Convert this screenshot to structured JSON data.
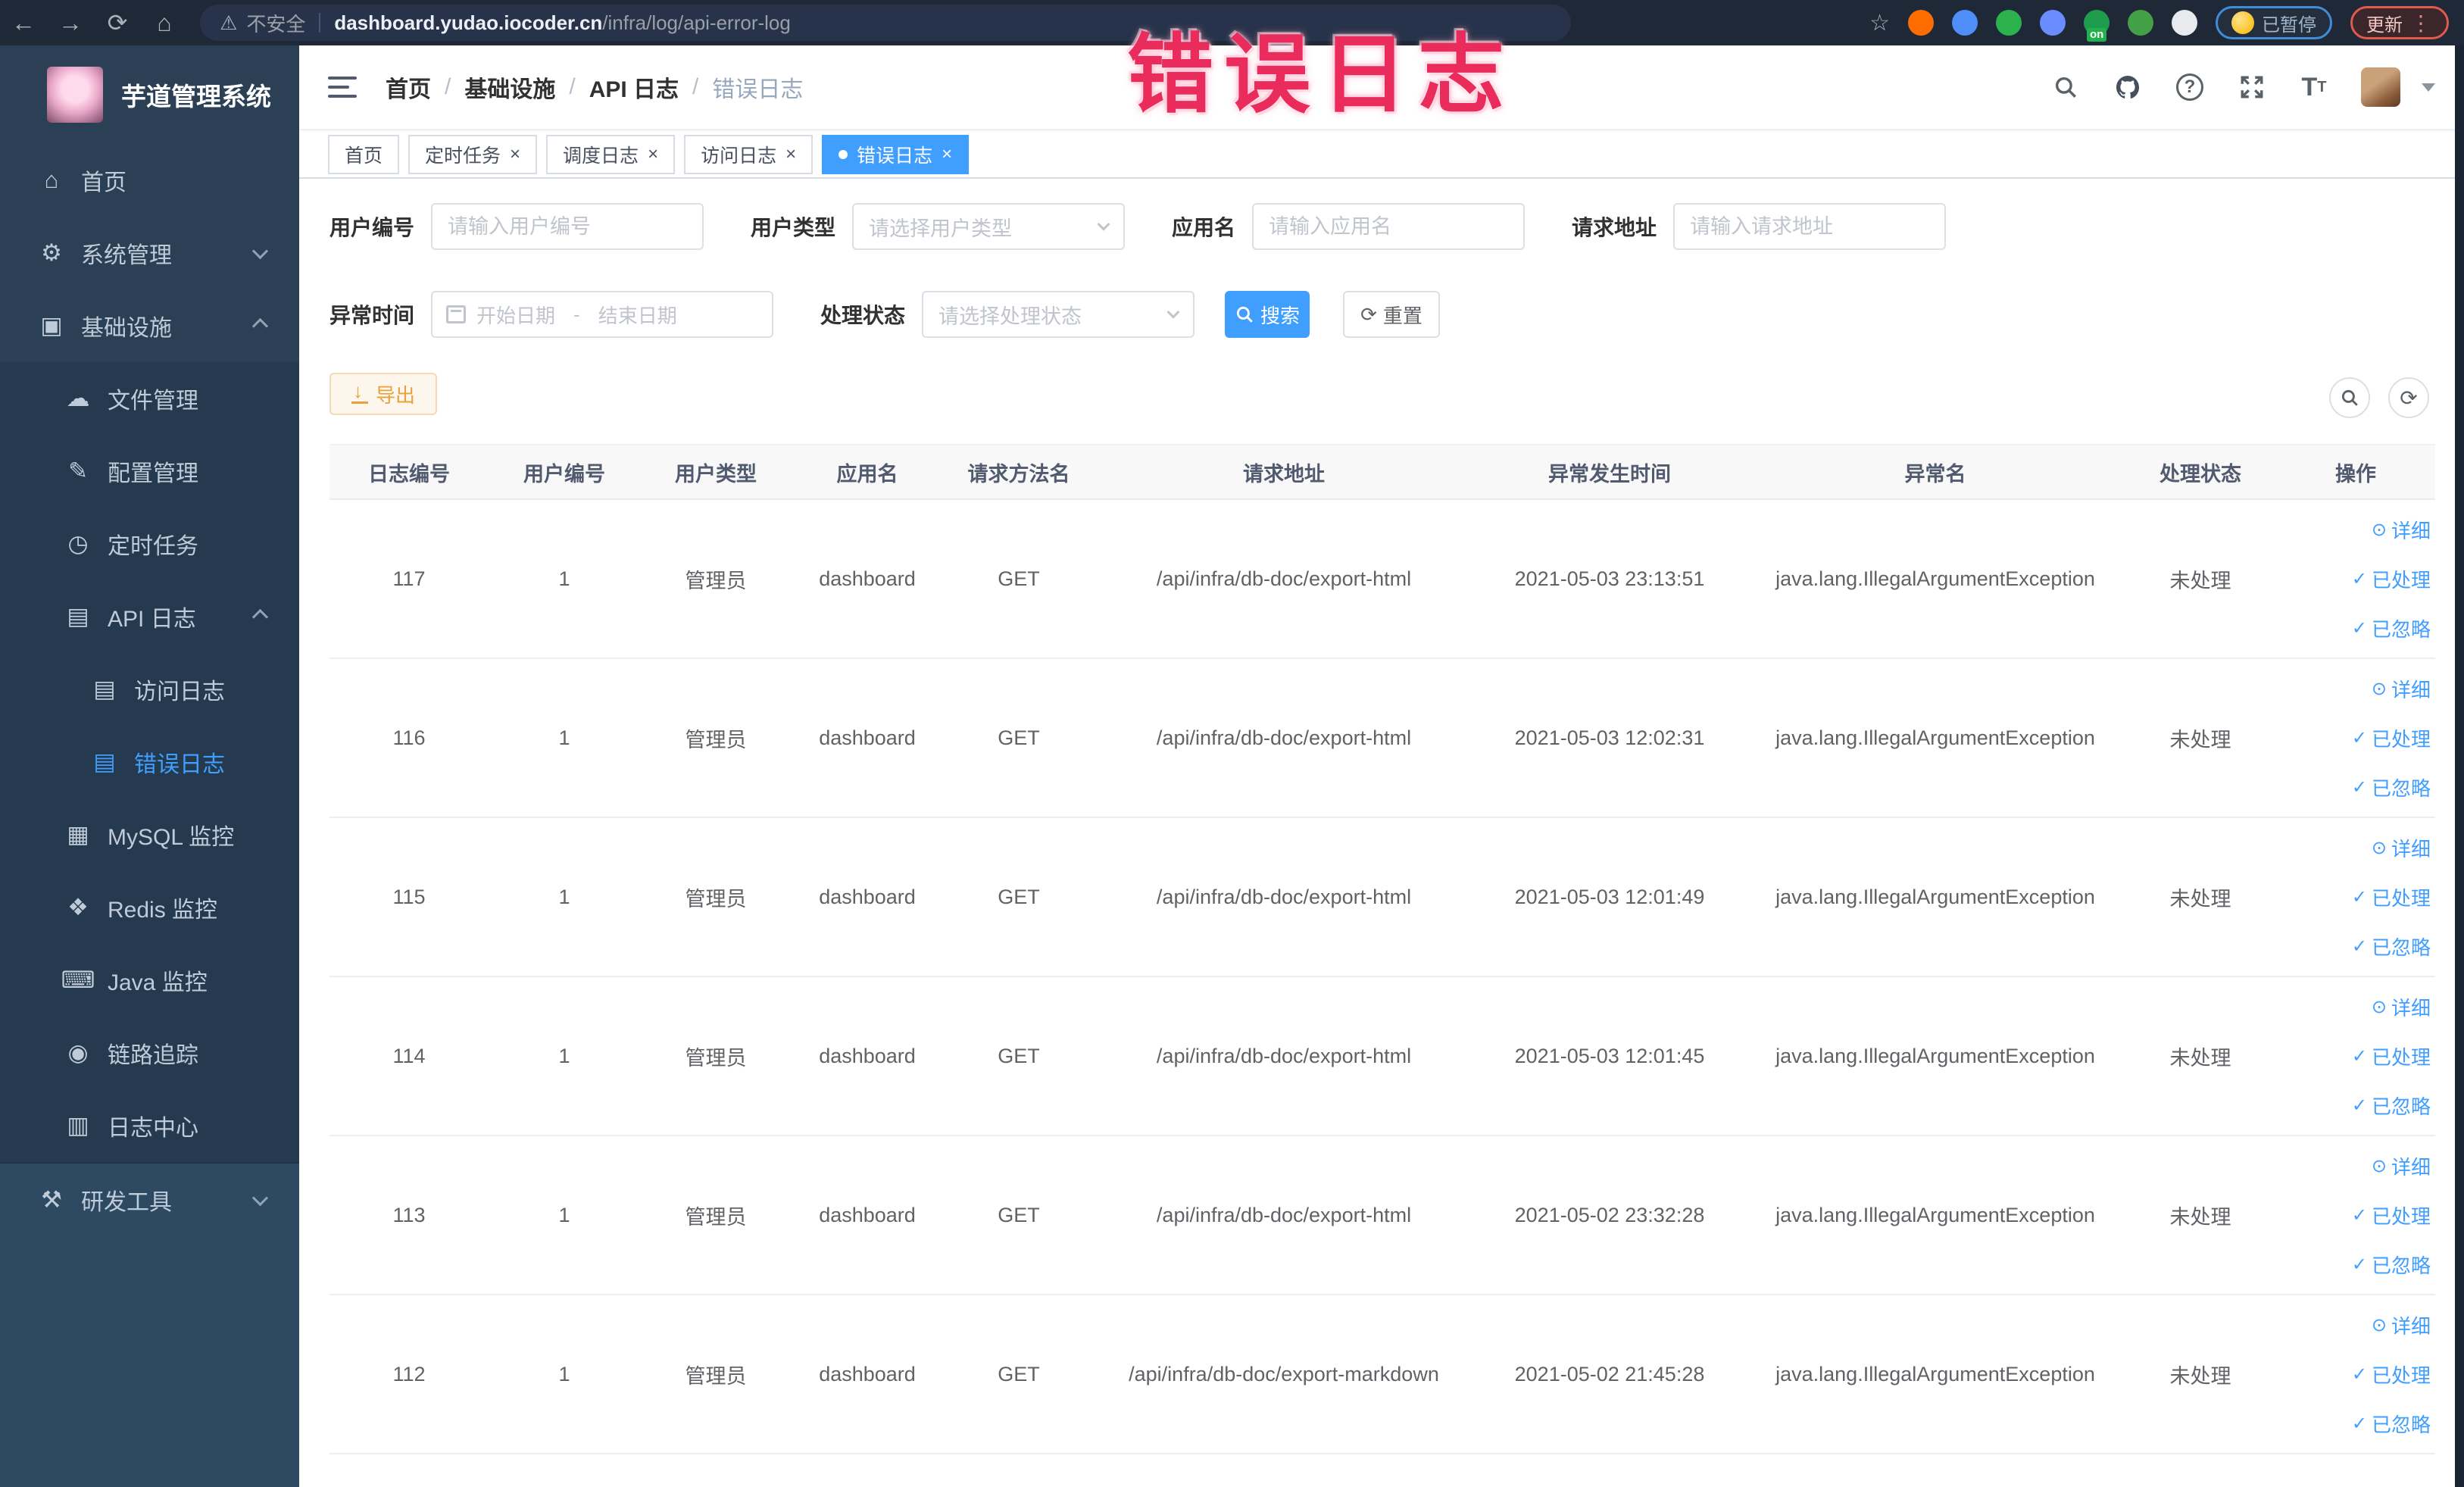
{
  "browser": {
    "security": "不安全",
    "url_domain": "dashboard.yudao.iocoder.cn",
    "url_path": "/infra/log/api-error-log",
    "paused_label": "已暂停",
    "update_label": "更新",
    "extensions": [
      {
        "name": "extension-orange-icon",
        "color": "#ff6d00"
      },
      {
        "name": "extension-blue-drop-icon",
        "color": "#4f8ef7"
      },
      {
        "name": "extension-green-v-icon",
        "color": "#2bb24c"
      },
      {
        "name": "extension-grid-icon",
        "color": "#6a8cff"
      },
      {
        "name": "extension-switch-icon",
        "color": "#1f9d4e",
        "badge": "on"
      },
      {
        "name": "extension-leaf-icon",
        "color": "#43a047"
      },
      {
        "name": "extension-paw-icon",
        "color": "#e8eaed"
      }
    ]
  },
  "overlay": {
    "title": "错误日志",
    "color": "#ea2c5c"
  },
  "sidebar": {
    "app_title": "芋道管理系统",
    "top_items": [
      {
        "label": "首页",
        "icon": "home",
        "level": "l1"
      },
      {
        "label": "系统管理",
        "icon": "gear",
        "level": "l1",
        "chevron": "down"
      },
      {
        "label": "基础设施",
        "icon": "infra",
        "level": "l1",
        "chevron": "up"
      }
    ],
    "sub_items": [
      {
        "label": "文件管理",
        "icon": "cloud",
        "level": "l2"
      },
      {
        "label": "配置管理",
        "icon": "edit",
        "level": "l2"
      },
      {
        "label": "定时任务",
        "icon": "timer",
        "level": "l2"
      },
      {
        "label": "API 日志",
        "icon": "apilog",
        "level": "l2",
        "chevron": "up"
      },
      {
        "label": "访问日志",
        "icon": "doclog",
        "level": "l3"
      },
      {
        "label": "错误日志",
        "icon": "doclog",
        "level": "l3",
        "active": true
      },
      {
        "label": "MySQL 监控",
        "icon": "mysql",
        "level": "l2"
      },
      {
        "label": "Redis 监控",
        "icon": "redis",
        "level": "l2"
      },
      {
        "label": "Java 监控",
        "icon": "java",
        "level": "l2"
      },
      {
        "label": "链路追踪",
        "icon": "trace",
        "level": "l2"
      },
      {
        "label": "日志中心",
        "icon": "logcenter",
        "level": "l2"
      }
    ],
    "bottom_items": [
      {
        "label": "研发工具",
        "icon": "tools",
        "level": "l1",
        "chevron": "down"
      }
    ]
  },
  "breadcrumb": [
    {
      "label": "首页",
      "sep": "/"
    },
    {
      "label": "基础设施",
      "sep": "/"
    },
    {
      "label": "API 日志",
      "sep": "/"
    },
    {
      "label": "错误日志",
      "current": true
    }
  ],
  "tabs": [
    {
      "label": "首页"
    },
    {
      "label": "定时任务",
      "closable": true
    },
    {
      "label": "调度日志",
      "closable": true
    },
    {
      "label": "访问日志",
      "closable": true
    },
    {
      "label": "错误日志",
      "closable": true,
      "active": true
    }
  ],
  "filters": {
    "user_id_label": "用户编号",
    "user_id_placeholder": "请输入用户编号",
    "user_type_label": "用户类型",
    "user_type_placeholder": "请选择用户类型",
    "app_name_label": "应用名",
    "app_name_placeholder": "请输入应用名",
    "request_url_label": "请求地址",
    "request_url_placeholder": "请输入请求地址",
    "time_label": "异常时间",
    "time_start_placeholder": "开始日期",
    "time_separator": "-",
    "time_end_placeholder": "结束日期",
    "status_label": "处理状态",
    "status_placeholder": "请选择处理状态",
    "search_label": "搜索",
    "reset_label": "重置"
  },
  "toolbar": {
    "export_label": "导出"
  },
  "table": {
    "columns": [
      {
        "label": "日志编号",
        "cls": "c1"
      },
      {
        "label": "用户编号",
        "cls": "c2"
      },
      {
        "label": "用户类型",
        "cls": "c3"
      },
      {
        "label": "应用名",
        "cls": "c4"
      },
      {
        "label": "请求方法名",
        "cls": "c5"
      },
      {
        "label": "请求地址",
        "cls": "c6"
      },
      {
        "label": "异常发生时间",
        "cls": "c7"
      },
      {
        "label": "异常名",
        "cls": "c8"
      },
      {
        "label": "处理状态",
        "cls": "c9"
      },
      {
        "label": "操作",
        "cls": "c10"
      }
    ],
    "rows": [
      {
        "id": "117",
        "user_id": "1",
        "user_type": "管理员",
        "app": "dashboard",
        "method": "GET",
        "url": "/api/infra/db-doc/export-html",
        "time": "2021-05-03 23:13:51",
        "exception": "java.lang.IllegalArgumentException",
        "status": "未处理"
      },
      {
        "id": "116",
        "user_id": "1",
        "user_type": "管理员",
        "app": "dashboard",
        "method": "GET",
        "url": "/api/infra/db-doc/export-html",
        "time": "2021-05-03 12:02:31",
        "exception": "java.lang.IllegalArgumentException",
        "status": "未处理"
      },
      {
        "id": "115",
        "user_id": "1",
        "user_type": "管理员",
        "app": "dashboard",
        "method": "GET",
        "url": "/api/infra/db-doc/export-html",
        "time": "2021-05-03 12:01:49",
        "exception": "java.lang.IllegalArgumentException",
        "status": "未处理"
      },
      {
        "id": "114",
        "user_id": "1",
        "user_type": "管理员",
        "app": "dashboard",
        "method": "GET",
        "url": "/api/infra/db-doc/export-html",
        "time": "2021-05-03 12:01:45",
        "exception": "java.lang.IllegalArgumentException",
        "status": "未处理"
      },
      {
        "id": "113",
        "user_id": "1",
        "user_type": "管理员",
        "app": "dashboard",
        "method": "GET",
        "url": "/api/infra/db-doc/export-html",
        "time": "2021-05-02 23:32:28",
        "exception": "java.lang.IllegalArgumentException",
        "status": "未处理"
      },
      {
        "id": "112",
        "user_id": "1",
        "user_type": "管理员",
        "app": "dashboard",
        "method": "GET",
        "url": "/api/infra/db-doc/export-markdown",
        "time": "2021-05-02 21:45:28",
        "exception": "java.lang.IllegalArgumentException",
        "status": "未处理"
      }
    ]
  },
  "row_actions": [
    {
      "label": "详细",
      "icon": "eye"
    },
    {
      "label": "已处理",
      "icon": "check"
    },
    {
      "label": "已忽略",
      "icon": "check"
    }
  ],
  "colors": {
    "accent": "#409eff",
    "warning": "#e6a23c",
    "sidebar_bg": "#2b4055"
  }
}
